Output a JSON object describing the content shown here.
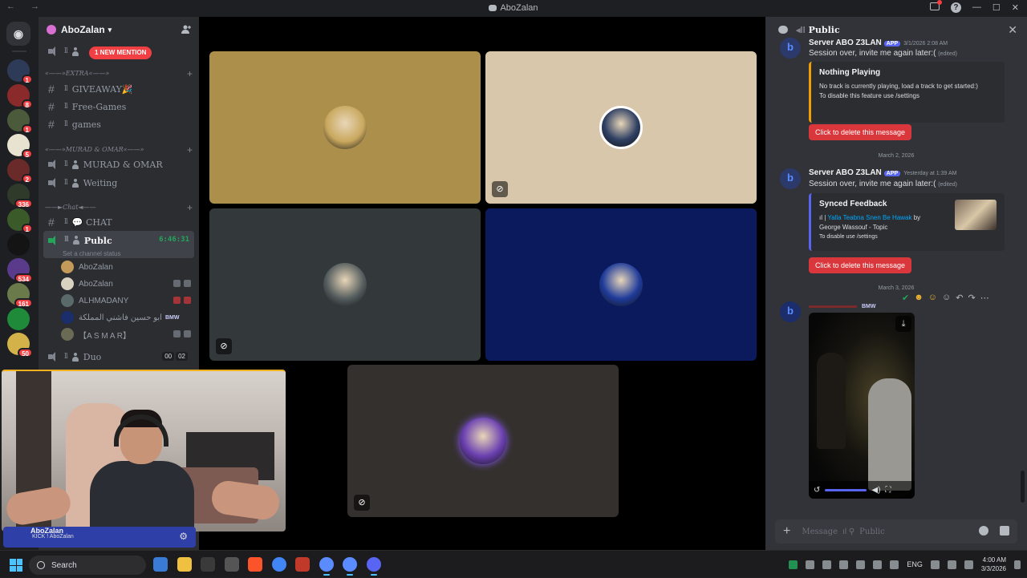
{
  "window": {
    "nav_arrows": "← →",
    "title": "AboZalan"
  },
  "rail": {
    "home_label": "",
    "servers": [
      {
        "color": "#2e3b58",
        "badge": "1"
      },
      {
        "color": "#8a2a2a",
        "badge": "8"
      },
      {
        "color": "#4a5a3a",
        "badge": "1"
      },
      {
        "color": "#e8e2d0",
        "badge": "5"
      },
      {
        "color": "#6b2a2a",
        "badge": "2"
      },
      {
        "color": "#2f3a2a",
        "badge": "336"
      },
      {
        "color": "#3a5a2a",
        "badge": "1"
      },
      {
        "color": "#141414",
        "badge": ""
      },
      {
        "color": "#5a3a8a",
        "badge": "534"
      },
      {
        "color": "#6a7a4a",
        "badge": "161"
      },
      {
        "color": "#1f8a3a",
        "badge": ""
      },
      {
        "color": "#d4b24a",
        "badge": "50"
      }
    ]
  },
  "sidebar": {
    "server_name": "AboZalan",
    "mention_pill": "1 NEW MENTION",
    "categories": {
      "extra": "«——»EXTRA«——»",
      "murad": "«——»MURAD & OMAR«——»",
      "chat": "——►Chat◄——"
    },
    "channels": {
      "giveaway": "GIVEAWAY🎉",
      "free_games": "Free-Games",
      "games": "games",
      "murad_omar": "MURAD & OMAR",
      "waiting": "Weiting",
      "chat": "💬 CHAT",
      "public": "Publc",
      "public_timer": "6:46:31",
      "public_status": "Set a channel status",
      "duo": "Duo",
      "duo_counts": [
        "00",
        "02"
      ]
    },
    "voice_users": [
      {
        "name": "AboZalan",
        "color": "#c49a5a",
        "tag": ""
      },
      {
        "name": "AboZalan",
        "color": "#d9d2c0",
        "tag": ""
      },
      {
        "name": "ALHMADANY",
        "color": "#5a6a6a",
        "tag": ""
      },
      {
        "name": "ابو حسين فاشني المملكة",
        "color": "#1b2d6b",
        "tag": "BMW"
      },
      {
        "name": "【A S M A R】",
        "color": "#6a6a55",
        "tag": ""
      }
    ],
    "user_panel": {
      "name": "AboZalan",
      "status": "KICK ! AboZalan"
    }
  },
  "stage": {
    "tiles": [
      {
        "name": "tile-1",
        "bg": "#ad8f4c",
        "pfp": "#c9a85e"
      },
      {
        "name": "tile-2",
        "bg": "#d8c7ab",
        "pfp": "#2e3f63"
      },
      {
        "name": "tile-3",
        "bg": "#33393a",
        "pfp": "#555d5e"
      },
      {
        "name": "tile-4",
        "bg": "#0b1a5c",
        "pfp": "#1f3b9a"
      },
      {
        "name": "tile-5",
        "bg": "#34302d",
        "pfp": "#6a3fb0"
      }
    ]
  },
  "chat": {
    "channel_title": "Public",
    "messages": [
      {
        "author": "Server ABO Z3LAN",
        "app_tag": "APP",
        "time": "3/1/2026 2:08 AM",
        "text": "Session over, invite me again later:(",
        "edited": "(edited)",
        "embed_title": "Nothing Playing",
        "embed_lines": [
          "No track is currently playing, load a track to get started:)",
          "To disable this feature use /settings"
        ],
        "button": "Click to delete this message"
      },
      {
        "author": "Server ABO Z3LAN",
        "app_tag": "APP",
        "time": "Yesterday at 1:39 AM",
        "text": "Session over, invite me again later:(",
        "edited": "(edited)",
        "embed_title": "Synced Feedback",
        "embed_link": "Yalla Teabna Snen Be Hawak",
        "embed_by": "by",
        "embed_artist": "George Wassouf - Topic",
        "embed_footer": "To disable use /settings",
        "button": "Click to delete this message"
      }
    ],
    "date_dividers": [
      "March 2, 2026",
      "March 3, 2026"
    ],
    "third_author_tag": "BMW",
    "composer_placeholder": "Message",
    "composer_channel": "Public"
  },
  "taskbar": {
    "search_label": "Search",
    "lang": "ENG",
    "time": "4:00 AM",
    "date": "3/3/2026",
    "apps": [
      {
        "color": "#3a7bd5",
        "active": false
      },
      {
        "color": "#f0c040",
        "active": false
      },
      {
        "color": "#3a3a3a",
        "active": false
      },
      {
        "color": "#555555",
        "active": false
      },
      {
        "color": "#fb542b",
        "active": false
      },
      {
        "color": "#4285f4",
        "active": false
      },
      {
        "color": "#c0392b",
        "active": false
      },
      {
        "color": "#5b8cff",
        "active": true
      },
      {
        "color": "#5b8cff",
        "active": true
      },
      {
        "color": "#5865f2",
        "active": true
      }
    ]
  }
}
